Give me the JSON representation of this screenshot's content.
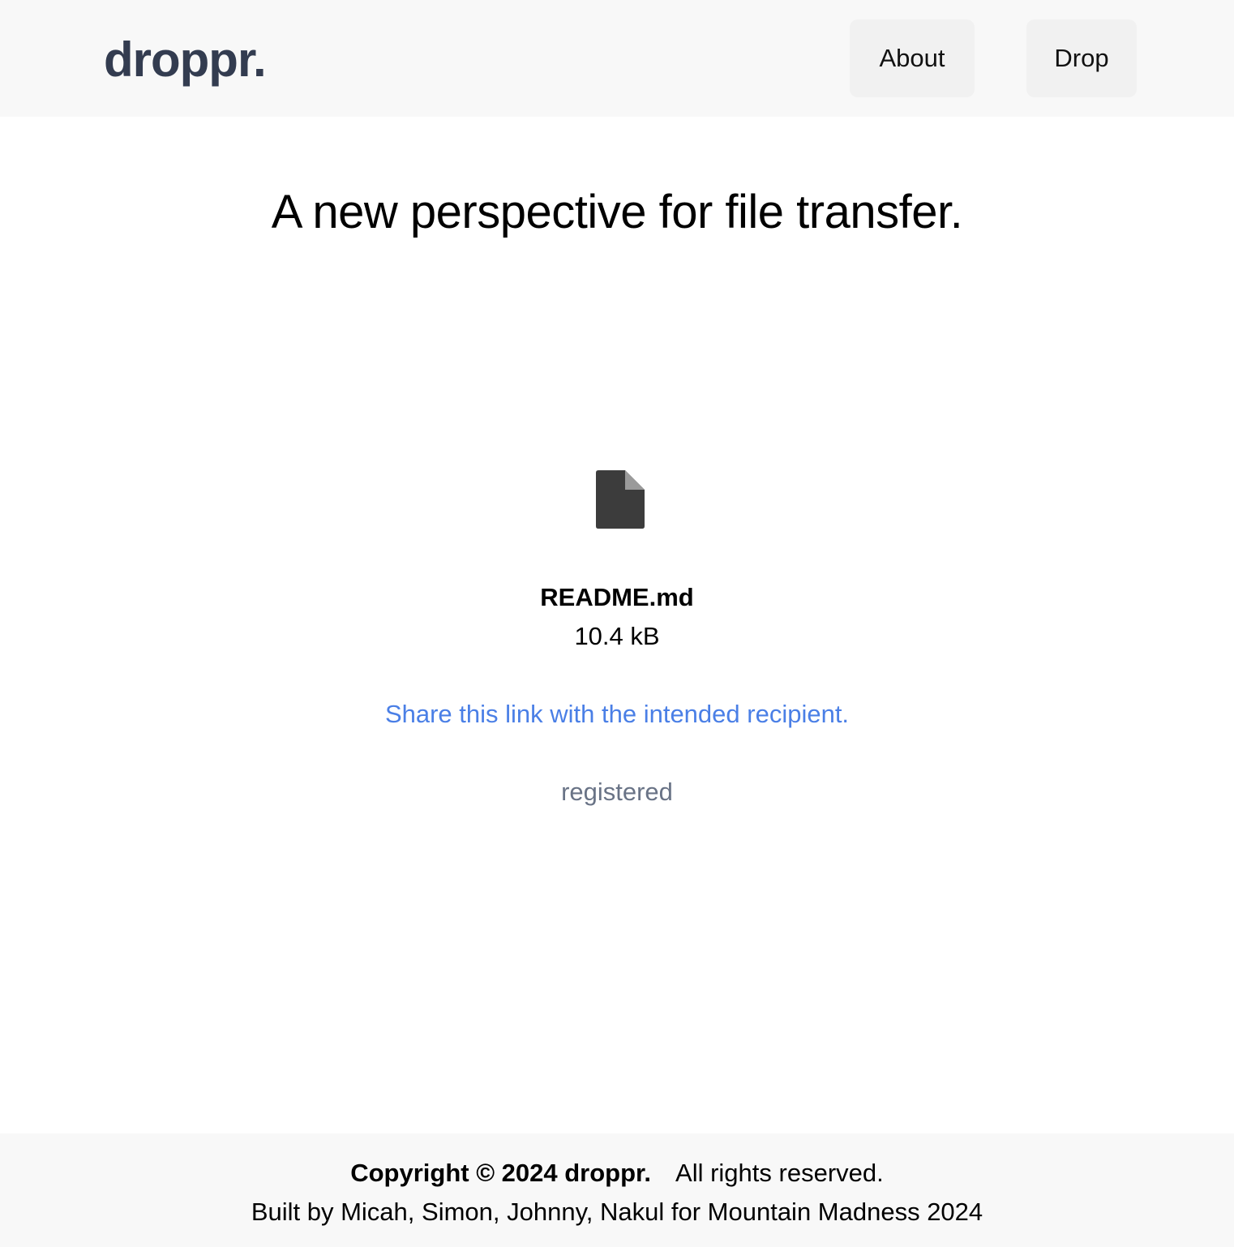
{
  "header": {
    "logo": "droppr.",
    "nav": {
      "about_label": "About",
      "drop_label": "Drop"
    }
  },
  "hero": {
    "headline": "A new perspective for file transfer."
  },
  "file": {
    "icon": "file-icon",
    "name": "README.md",
    "size": "10.4 kB"
  },
  "share": {
    "link_text": "Share this link with the intended recipient."
  },
  "status": {
    "text": "registered"
  },
  "footer": {
    "copyright": "Copyright © 2024 droppr.",
    "rights": "All rights reserved.",
    "credits": "Built by Micah, Simon, Johnny, Nakul for Mountain Madness 2024"
  },
  "colors": {
    "logo": "#333c50",
    "link": "#4a7fe6",
    "status": "#697386",
    "header_bg": "#f8f8f8",
    "icon_fill": "#3c3c3c"
  }
}
